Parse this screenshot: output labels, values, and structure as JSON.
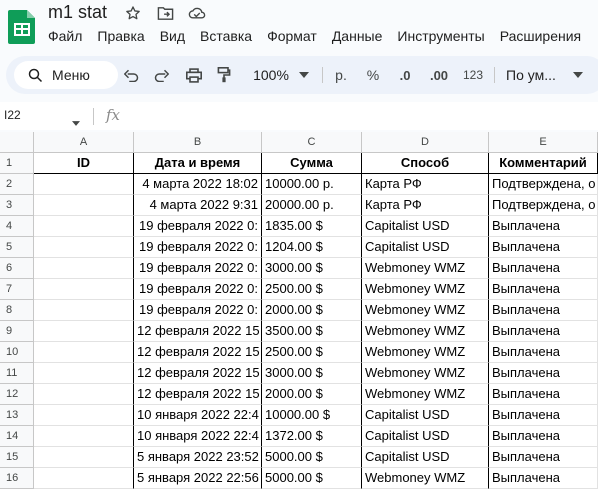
{
  "app": {
    "doc_title": "m1 stat",
    "menu": [
      "Файл",
      "Правка",
      "Вид",
      "Вставка",
      "Формат",
      "Данные",
      "Инструменты",
      "Расширения"
    ]
  },
  "toolbar": {
    "search_label": "Меню",
    "zoom": "100%",
    "currency_label": "р.",
    "percent_label": "%",
    "decrease_decimals_label": ".0",
    "increase_decimals_label": ".00",
    "number_format_label": "123",
    "font_label": "По ум..."
  },
  "formula_bar": {
    "cell_ref": "I22",
    "fx_label": "fx"
  },
  "sheet": {
    "columns": [
      "A",
      "B",
      "C",
      "D",
      "E"
    ],
    "header": [
      "ID",
      "Дата и время",
      "Сумма",
      "Способ",
      "Комментарий"
    ],
    "row_numbers": [
      "1",
      "2",
      "3",
      "4",
      "5",
      "6",
      "7",
      "8",
      "9",
      "10",
      "11",
      "12",
      "13",
      "14",
      "15",
      "16"
    ],
    "rows": [
      [
        "",
        "4 марта 2022 18:02",
        "10000.00 р.",
        "Карта РФ",
        "Подтверждена, о"
      ],
      [
        "",
        "4 марта 2022 9:31",
        "20000.00 р.",
        "Карта РФ",
        "Подтверждена, о"
      ],
      [
        "",
        "19 февраля 2022 0:",
        "1835.00 $",
        "Capitalist USD",
        "Выплачена"
      ],
      [
        "",
        "19 февраля 2022 0:",
        "1204.00 $",
        "Capitalist USD",
        "Выплачена"
      ],
      [
        "",
        "19 февраля 2022 0:",
        "3000.00 $",
        "Webmoney WMZ",
        "Выплачена"
      ],
      [
        "",
        "19 февраля 2022 0:",
        "2500.00 $",
        "Webmoney WMZ",
        "Выплачена"
      ],
      [
        "",
        "19 февраля 2022 0:",
        "2000.00 $",
        "Webmoney WMZ",
        "Выплачена"
      ],
      [
        "",
        "12 февраля 2022 15",
        "3500.00 $",
        "Webmoney WMZ",
        "Выплачена"
      ],
      [
        "",
        "12 февраля 2022 15",
        "2500.00 $",
        "Webmoney WMZ",
        "Выплачена"
      ],
      [
        "",
        "12 февраля 2022 15",
        "3000.00 $",
        "Webmoney WMZ",
        "Выплачена"
      ],
      [
        "",
        "12 февраля 2022 15",
        "2000.00 $",
        "Webmoney WMZ",
        "Выплачена"
      ],
      [
        "",
        "10 января 2022 22:4",
        "10000.00 $",
        "Capitalist USD",
        "Выплачена"
      ],
      [
        "",
        "10 января 2022 22:4",
        "1372.00 $",
        "Capitalist USD",
        "Выплачена"
      ],
      [
        "",
        "5 января 2022 23:52",
        "5000.00 $",
        "Capitalist USD",
        "Выплачена"
      ],
      [
        "",
        "5 января 2022 22:56",
        "5000.00 $",
        "Webmoney WMZ",
        "Выплачена"
      ]
    ]
  },
  "colors": {
    "logo_green": "#0f9d58",
    "toolbar_bg": "#edf2fa",
    "header_bg": "#f8f9fa"
  }
}
